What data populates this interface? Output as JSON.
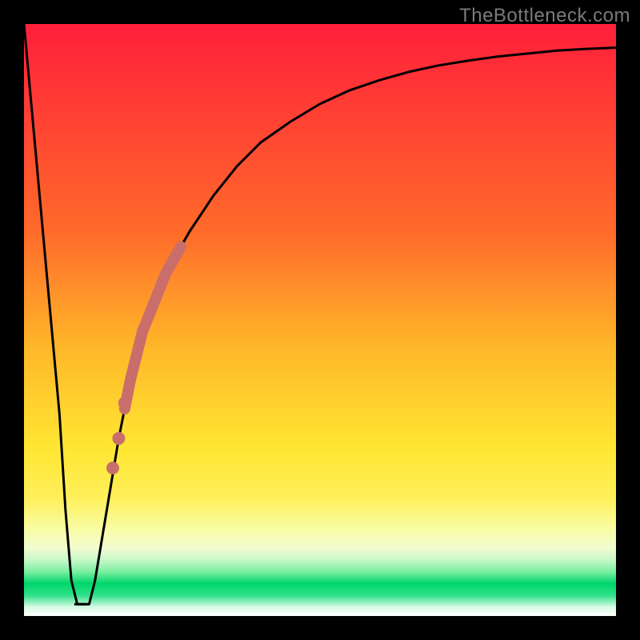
{
  "watermark": "TheBottleneck.com",
  "colors": {
    "frame": "#000000",
    "curve": "#000000",
    "dot": "#c96e6b",
    "gradient_top": "#ff1f3a",
    "gradient_yellow": "#ffe733",
    "gradient_band_light": "#f6fca5",
    "gradient_green_light": "#8ff7a8",
    "gradient_green": "#00d66b",
    "gradient_green_bottom": "#00a851"
  },
  "chart_data": {
    "type": "line",
    "title": "",
    "xlabel": "",
    "ylabel": "",
    "xlim": [
      0,
      100
    ],
    "ylim": [
      0,
      100
    ],
    "grid": false,
    "legend": null,
    "series": [
      {
        "name": "bottleneck-curve",
        "x": [
          0,
          2,
          4,
          6,
          7,
          8,
          9,
          10,
          11,
          12,
          14,
          16,
          18,
          20,
          24,
          28,
          32,
          36,
          40,
          45,
          50,
          55,
          60,
          65,
          70,
          75,
          80,
          85,
          90,
          95,
          100
        ],
        "y": [
          100,
          78,
          56,
          34,
          18,
          6,
          2,
          2,
          2,
          6,
          18,
          30,
          40,
          48,
          58,
          65,
          71,
          76,
          80,
          83.5,
          86.5,
          88.8,
          90.5,
          91.9,
          93,
          93.8,
          94.5,
          95,
          95.5,
          95.8,
          96
        ]
      }
    ],
    "optimum_flat": {
      "x_range": [
        8.5,
        10.5
      ],
      "y": 2
    },
    "highlight_segment": {
      "name": "dense-marker-segment",
      "x_range": [
        17,
        26.5
      ],
      "y_range": [
        36,
        62
      ]
    },
    "markers": [
      {
        "x": 15,
        "y": 25
      },
      {
        "x": 16,
        "y": 30
      },
      {
        "x": 17,
        "y": 36
      }
    ]
  }
}
